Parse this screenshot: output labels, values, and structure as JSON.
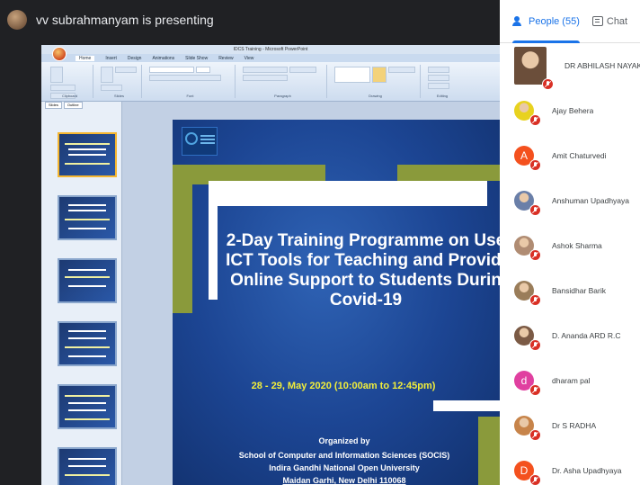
{
  "presenter": {
    "text": "vv subrahmanyam is presenting"
  },
  "ppt": {
    "window_title": "IDCS Training - Microsoft PowerPoint",
    "tabs": [
      "Home",
      "Insert",
      "Design",
      "Animations",
      "Slide Show",
      "Review",
      "View"
    ],
    "ribbon_groups": [
      "Clipboard",
      "Slides",
      "Font",
      "Paragraph",
      "Drawing",
      "Editing"
    ],
    "panel_tabs": [
      "Slides",
      "Outline"
    ]
  },
  "slide": {
    "title": "2-Day Training Programme on Use\nICT Tools for Teaching and Providi\nOnline Support to Students Durin\nCovid-19",
    "date": "28 - 29, May 2020 (10:00am to 12:45pm)",
    "org": {
      "label": "Organized by",
      "school": "School of Computer and Information Sciences (SOCIS)",
      "university": "Indira Gandhi National Open University",
      "address": "Maidan Garhi, New Delhi 110068"
    }
  },
  "side": {
    "tabs": {
      "people": "People (55)",
      "chat": "Chat"
    },
    "participants": [
      {
        "name": "DR ABHILASH NAYAK (You)",
        "avatar": "photo",
        "color": "#6b4e3a"
      },
      {
        "name": "Ajay Behera",
        "avatar": "photo",
        "color": "#e8d21f"
      },
      {
        "name": "Amit Chaturvedi",
        "avatar": "A",
        "color": "#f4511e"
      },
      {
        "name": "Anshuman Upadhyaya",
        "avatar": "photo",
        "color": "#6a7fa8"
      },
      {
        "name": "Ashok Sharma",
        "avatar": "photo",
        "color": "#b08c73"
      },
      {
        "name": "Bansidhar Barik",
        "avatar": "photo",
        "color": "#9a7d5a"
      },
      {
        "name": "D. Ananda ARD R.C",
        "avatar": "photo",
        "color": "#7b5a45"
      },
      {
        "name": "dharam pal",
        "avatar": "d",
        "color": "#e040a0"
      },
      {
        "name": "Dr S RADHA",
        "avatar": "photo",
        "color": "#c7844a"
      },
      {
        "name": "Dr. Asha Upadhyaya",
        "avatar": "D",
        "color": "#f4511e"
      }
    ]
  }
}
